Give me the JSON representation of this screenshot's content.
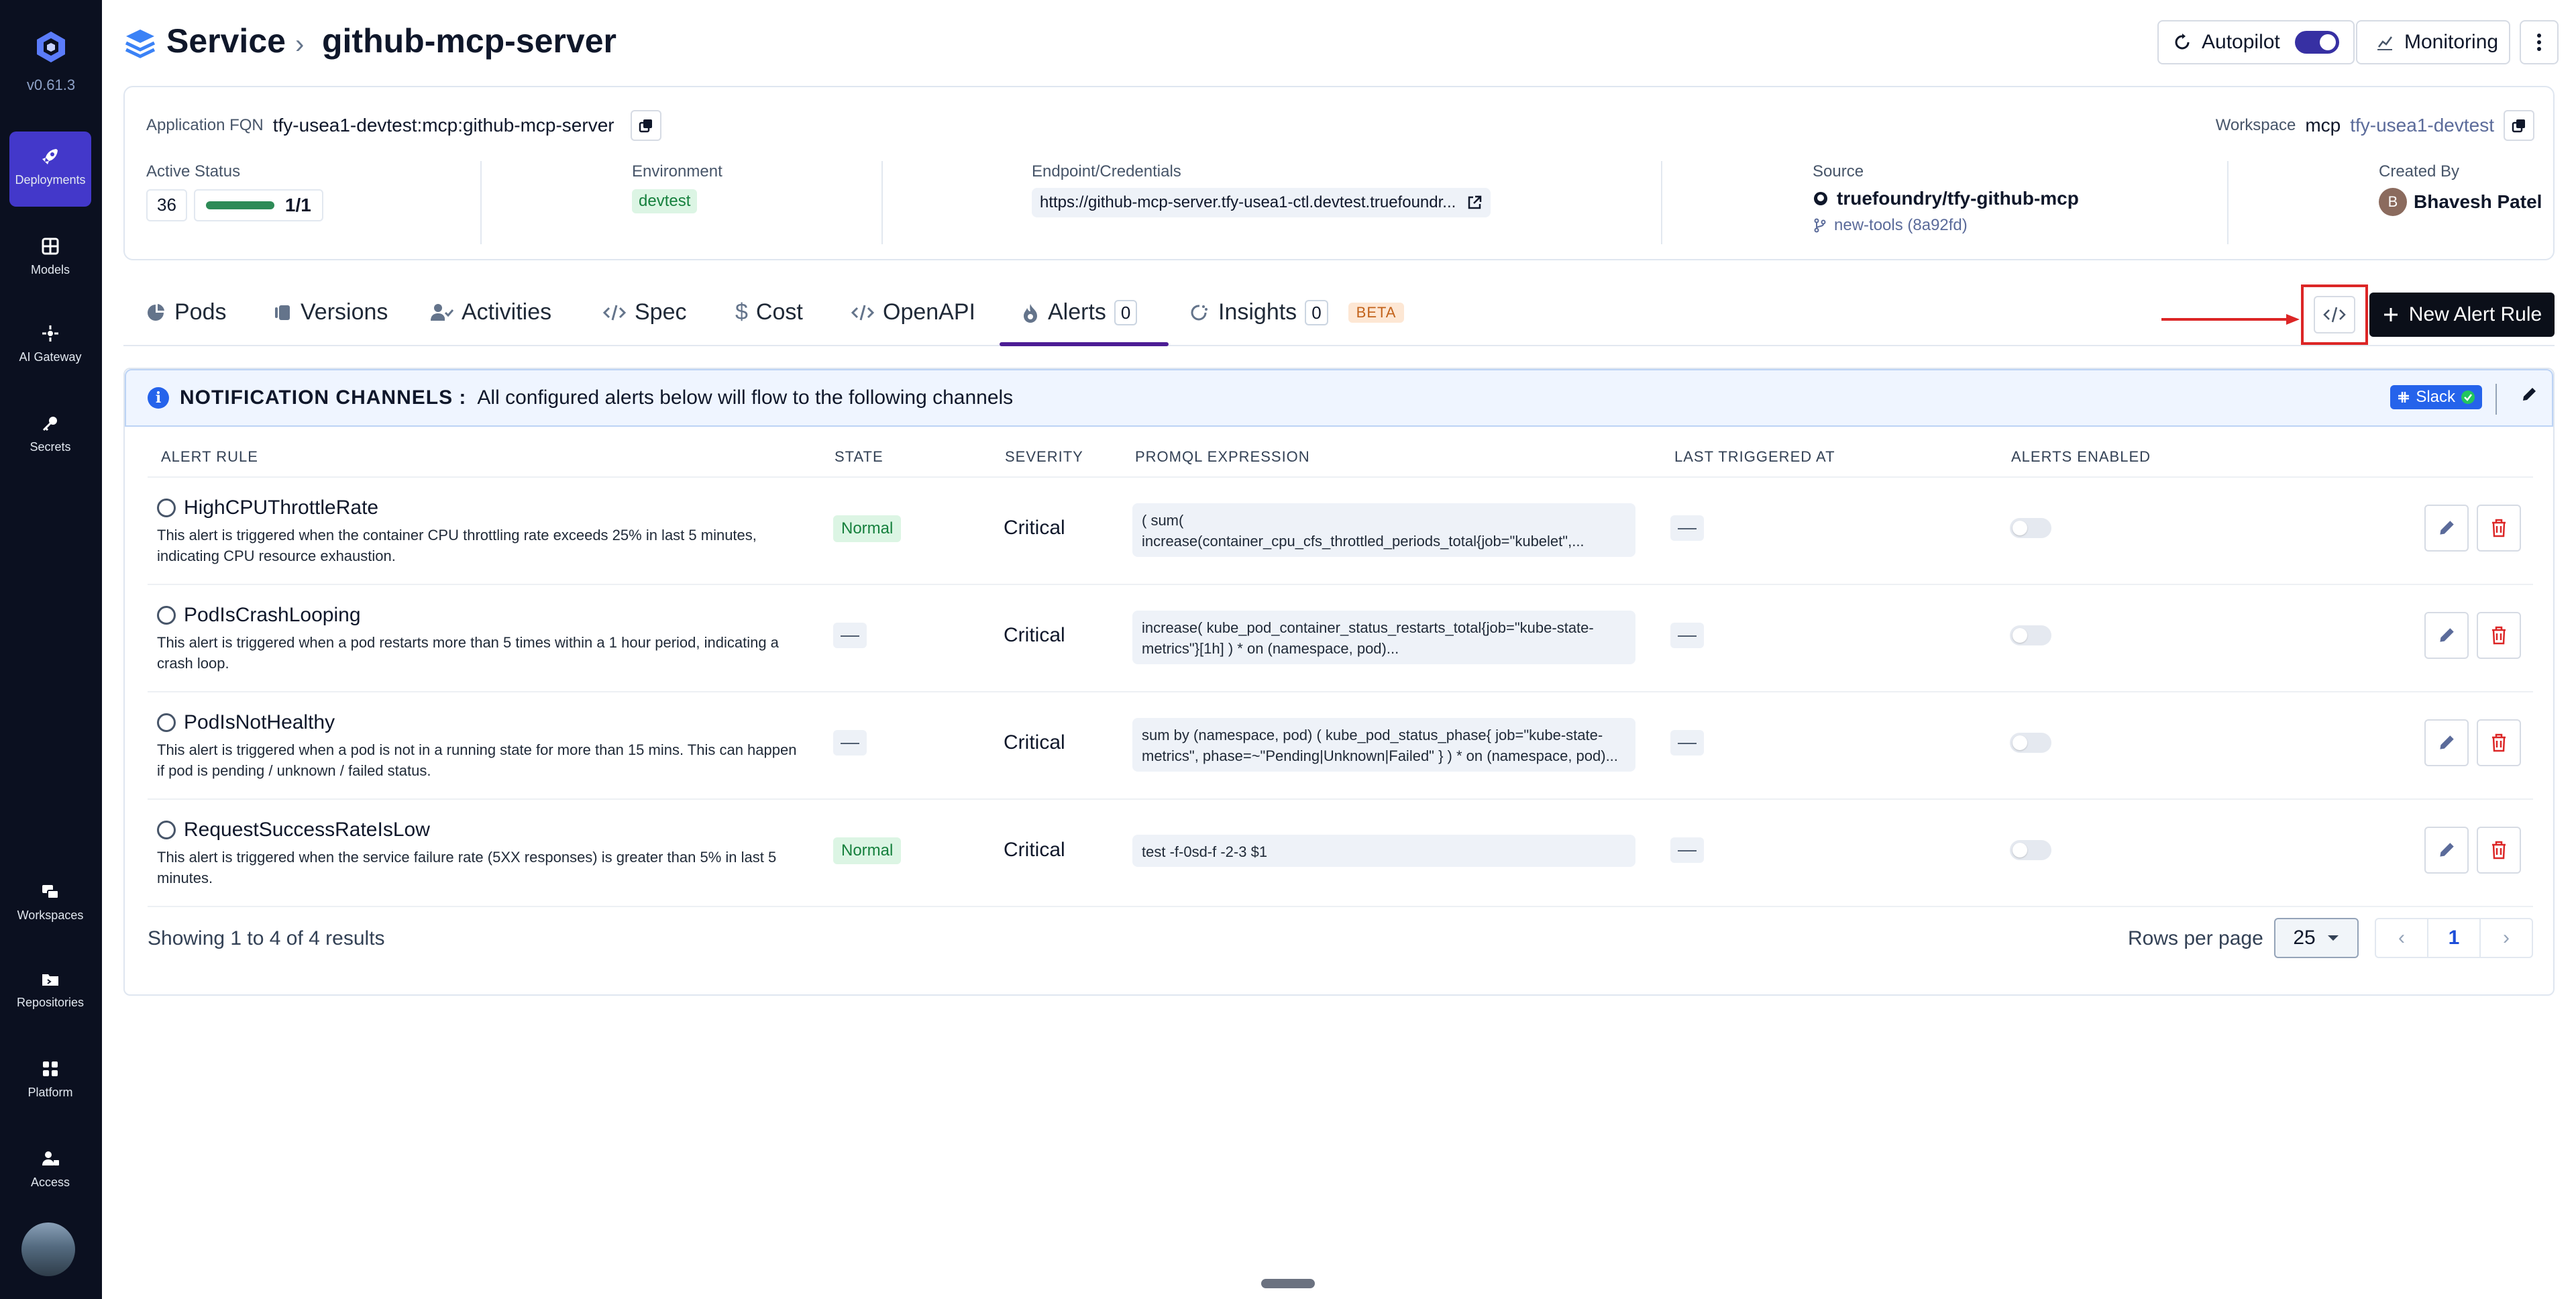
{
  "app": {
    "version": "v0.61.3"
  },
  "sidebar": {
    "items": [
      {
        "label": "Deployments",
        "icon": "rocket-icon",
        "active": true
      },
      {
        "label": "Models",
        "icon": "grid-icon"
      },
      {
        "label": "AI Gateway",
        "icon": "gateway-icon"
      },
      {
        "label": "Secrets",
        "icon": "key-icon"
      },
      {
        "label": "Workspaces",
        "icon": "workspaces-icon"
      },
      {
        "label": "Repositories",
        "icon": "folder-icon"
      },
      {
        "label": "Platform",
        "icon": "apps-icon"
      },
      {
        "label": "Access",
        "icon": "user-lock-icon"
      }
    ]
  },
  "header": {
    "breadcrumb_root": "Service",
    "separator": "›",
    "title": "github-mcp-server",
    "autopilot_label": "Autopilot",
    "autopilot_on": true,
    "monitoring_label": "Monitoring"
  },
  "info": {
    "fqn_label": "Application FQN",
    "fqn_value": "tfy-usea1-devtest:mcp:github-mcp-server",
    "workspace_label": "Workspace",
    "workspace_name": "mcp",
    "workspace_cluster": "tfy-usea1-devtest",
    "active_status_label": "Active Status",
    "active_count": "36",
    "replicas": "1/1",
    "environment_label": "Environment",
    "environment_value": "devtest",
    "endpoint_label": "Endpoint/Credentials",
    "endpoint_value": "https://github-mcp-server.tfy-usea1-ctl.devtest.truefoundr...",
    "source_label": "Source",
    "source_repo": "truefoundry/tfy-github-mcp",
    "source_branch": "new-tools (8a92fd)",
    "created_by_label": "Created By",
    "creator_initial": "B",
    "creator_name": "Bhavesh Patel"
  },
  "tabs": [
    {
      "label": "Pods"
    },
    {
      "label": "Versions"
    },
    {
      "label": "Activities"
    },
    {
      "label": "Spec"
    },
    {
      "label": "Cost"
    },
    {
      "label": "OpenAPI"
    },
    {
      "label": "Alerts",
      "count": "0",
      "active": true
    },
    {
      "label": "Insights",
      "count": "0",
      "badge": "BETA"
    }
  ],
  "actions": {
    "new_alert_label": "New Alert Rule"
  },
  "notification": {
    "title": "NOTIFICATION CHANNELS :",
    "text": "All configured alerts below will flow to the following channels",
    "channel": "Slack"
  },
  "table": {
    "headers": [
      "ALERT RULE",
      "STATE",
      "SEVERITY",
      "PROMQL EXPRESSION",
      "LAST TRIGGERED AT",
      "ALERTS ENABLED"
    ],
    "rows": [
      {
        "name": "HighCPUThrottleRate",
        "desc": "This alert is triggered when the container CPU throttling rate exceeds 25% in last 5 minutes, indicating CPU resource exhaustion.",
        "state": "Normal",
        "severity": "Critical",
        "promql": "( sum( increase(container_cpu_cfs_throttled_periods_total{job=\"kubelet\",...",
        "last_triggered": "—",
        "enabled": false
      },
      {
        "name": "PodIsCrashLooping",
        "desc": "This alert is triggered when a pod restarts more than 5 times within a 1 hour period, indicating a crash loop.",
        "state": "—",
        "severity": "Critical",
        "promql": "increase( kube_pod_container_status_restarts_total{job=\"kube-state-metrics\"}[1h] ) * on (namespace, pod)...",
        "last_triggered": "—",
        "enabled": false
      },
      {
        "name": "PodIsNotHealthy",
        "desc": "This alert is triggered when a pod is not in a running state for more than 15 mins. This can happen if pod is pending / unknown / failed status.",
        "state": "—",
        "severity": "Critical",
        "promql": "sum by (namespace, pod) ( kube_pod_status_phase{ job=\"kube-state-metrics\", phase=~\"Pending|Unknown|Failed\" } ) * on (namespace, pod)...",
        "last_triggered": "—",
        "enabled": false
      },
      {
        "name": "RequestSuccessRateIsLow",
        "desc": "This alert is triggered when the service failure rate (5XX responses) is greater than 5% in last 5 minutes.",
        "state": "Normal",
        "severity": "Critical",
        "promql": "test -f-0sd-f -2-3 $1",
        "last_triggered": "—",
        "enabled": false
      }
    ]
  },
  "pagination": {
    "showing": "Showing 1 to 4 of 4 results",
    "rows_per_page_label": "Rows per page",
    "rows_per_page": "25",
    "current_page": "1",
    "prev": "‹",
    "next": "›"
  }
}
